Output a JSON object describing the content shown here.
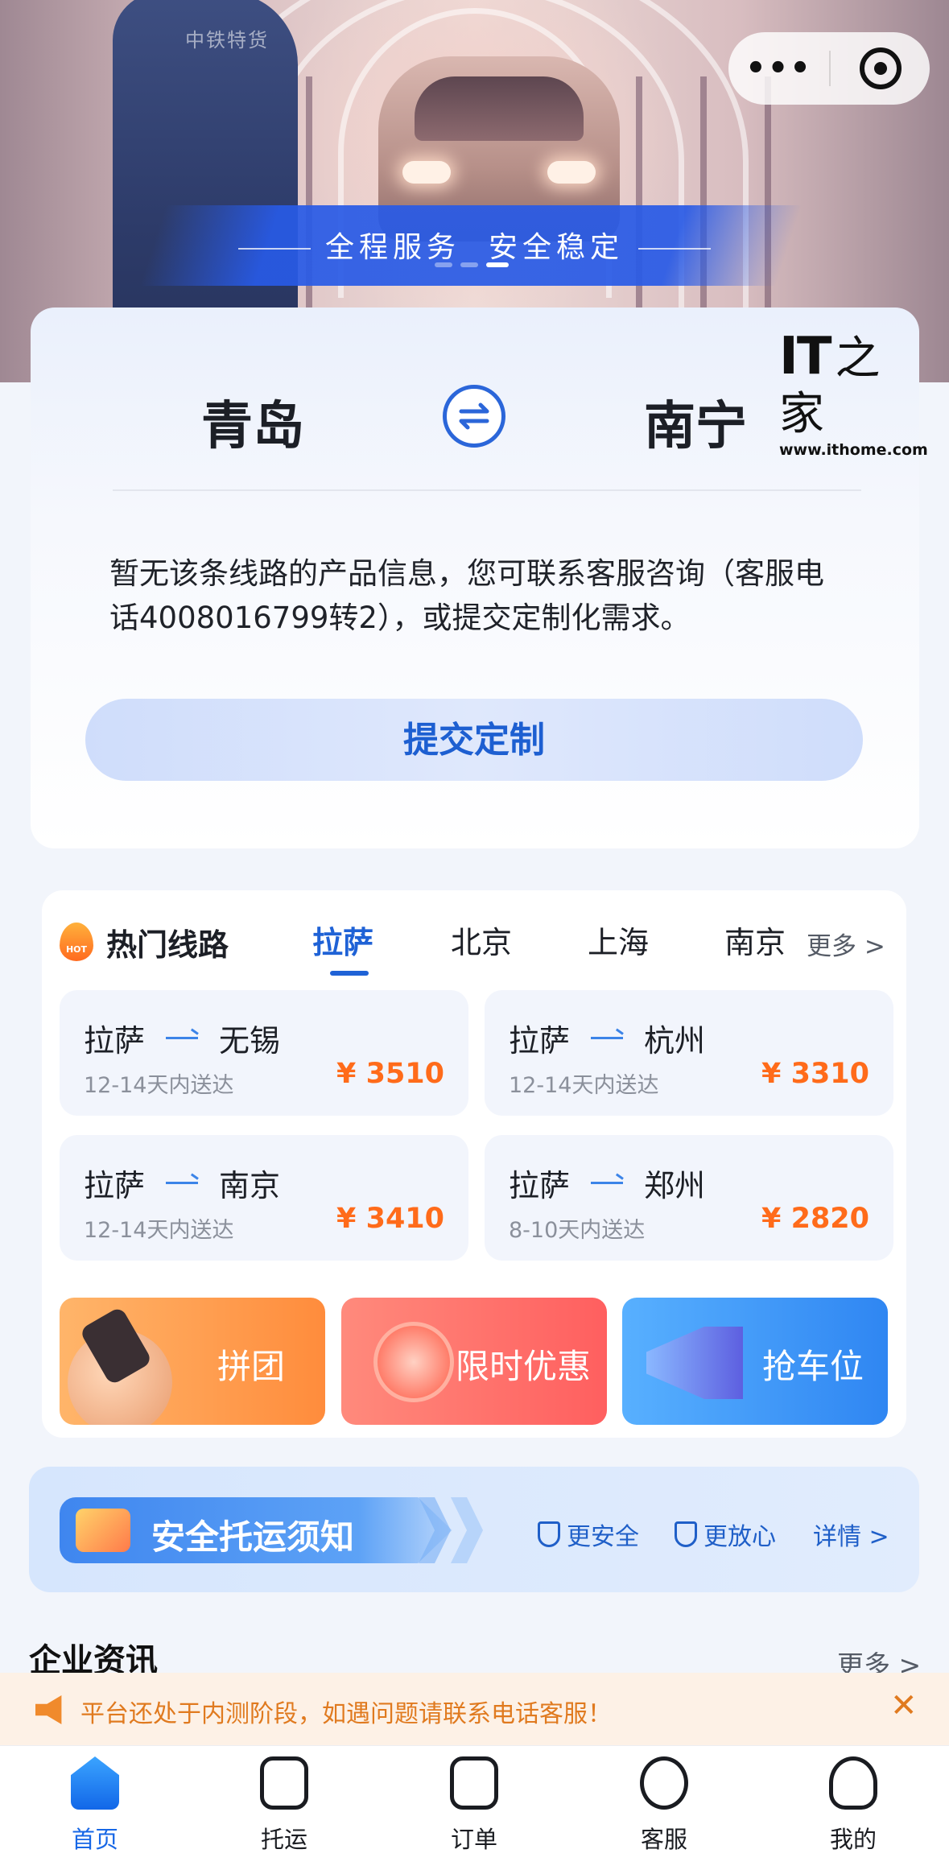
{
  "hero": {
    "worker_label": "中铁特货",
    "slogan_left": "全程服务",
    "slogan_right": "安全稳定",
    "capsule_more": "•••"
  },
  "watermark": {
    "logo": "IT",
    "logo_glyph": "之家",
    "url": "www.ithome.com"
  },
  "route": {
    "from": "青岛",
    "to": "南宁",
    "swap_icon": "swap-arrows-icon",
    "message": "暂无该条线路的产品信息，您可联系客服咨询（客服电话4008016799转2），或提交定制化需求。",
    "submit_label": "提交定制"
  },
  "hot": {
    "title": "热门线路",
    "fire_badge": "HOT",
    "tabs": [
      "拉萨",
      "北京",
      "上海",
      "南京"
    ],
    "active_tab": 0,
    "more": "更多 >",
    "items": [
      {
        "from": "拉萨",
        "to": "无锡",
        "days": "12-14天内送达",
        "price": "¥ 3510"
      },
      {
        "from": "拉萨",
        "to": "杭州",
        "days": "12-14天内送达",
        "price": "¥ 3310"
      },
      {
        "from": "拉萨",
        "to": "南京",
        "days": "12-14天内送达",
        "price": "¥ 3410"
      },
      {
        "from": "拉萨",
        "to": "郑州",
        "days": "8-10天内送达",
        "price": "¥ 2820"
      }
    ]
  },
  "promos": [
    {
      "label": "拼团",
      "icon": "group-buy-hand-icon",
      "color": "#ff8c3c"
    },
    {
      "label": "限时优惠",
      "icon": "alarm-clock-icon",
      "color": "#ff5f5f"
    },
    {
      "label": "抢车位",
      "icon": "megaphone-icon",
      "color": "#2f86f2"
    }
  ],
  "safety": {
    "title": "安全托运须知",
    "safer": "更安全",
    "assured": "更放心",
    "details": "详情 >"
  },
  "news": {
    "title": "企业资讯",
    "more": "更多 >"
  },
  "notice": {
    "text": "平台还处于内测阶段，如遇问题请联系电话客服！",
    "close": "✕"
  },
  "tabbar": [
    {
      "label": "首页",
      "icon": "home-icon",
      "active": true
    },
    {
      "label": "托运",
      "icon": "train-icon",
      "active": false
    },
    {
      "label": "订单",
      "icon": "order-clipboard-icon",
      "active": false
    },
    {
      "label": "客服",
      "icon": "headset-icon",
      "active": false
    },
    {
      "label": "我的",
      "icon": "person-icon",
      "active": false
    }
  ],
  "colors": {
    "primary": "#1f62d6",
    "price": "#ff6b1a",
    "notice": "#e07a1f"
  }
}
